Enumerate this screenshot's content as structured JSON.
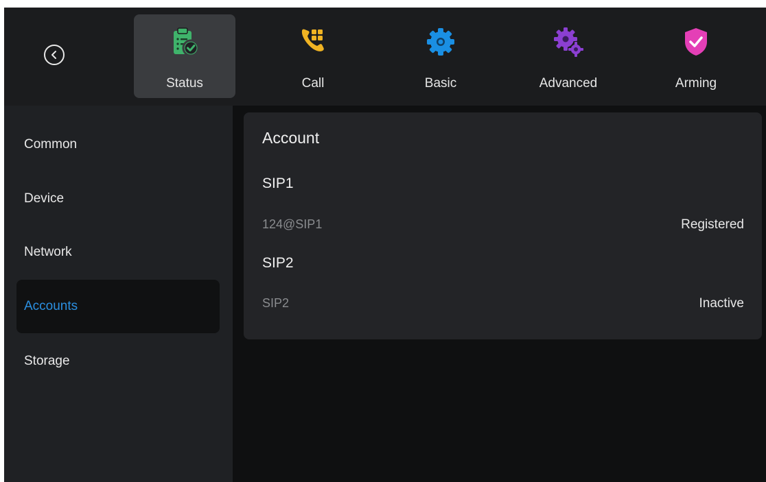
{
  "nav": {
    "tabs": [
      {
        "label": "Status",
        "icon": "clipboard-check-icon",
        "color": "#3fb36b"
      },
      {
        "label": "Call",
        "icon": "phone-grid-icon",
        "color": "#f0b323"
      },
      {
        "label": "Basic",
        "icon": "gear-icon",
        "color": "#1a8fe3"
      },
      {
        "label": "Advanced",
        "icon": "gears-icon",
        "color": "#8b3fd1"
      },
      {
        "label": "Arming",
        "icon": "shield-check-icon",
        "color": "#e43fb6"
      }
    ],
    "active_tab": "Status"
  },
  "sidebar": {
    "items": [
      {
        "label": "Common"
      },
      {
        "label": "Device"
      },
      {
        "label": "Network"
      },
      {
        "label": "Accounts"
      },
      {
        "label": "Storage"
      }
    ],
    "active_item": "Accounts",
    "active_color": "#2b8fe0"
  },
  "card": {
    "title": "Account",
    "accounts": [
      {
        "heading": "SIP1",
        "name": "124@SIP1",
        "status": "Registered"
      },
      {
        "heading": "SIP2",
        "name": "SIP2",
        "status": "Inactive"
      }
    ]
  }
}
